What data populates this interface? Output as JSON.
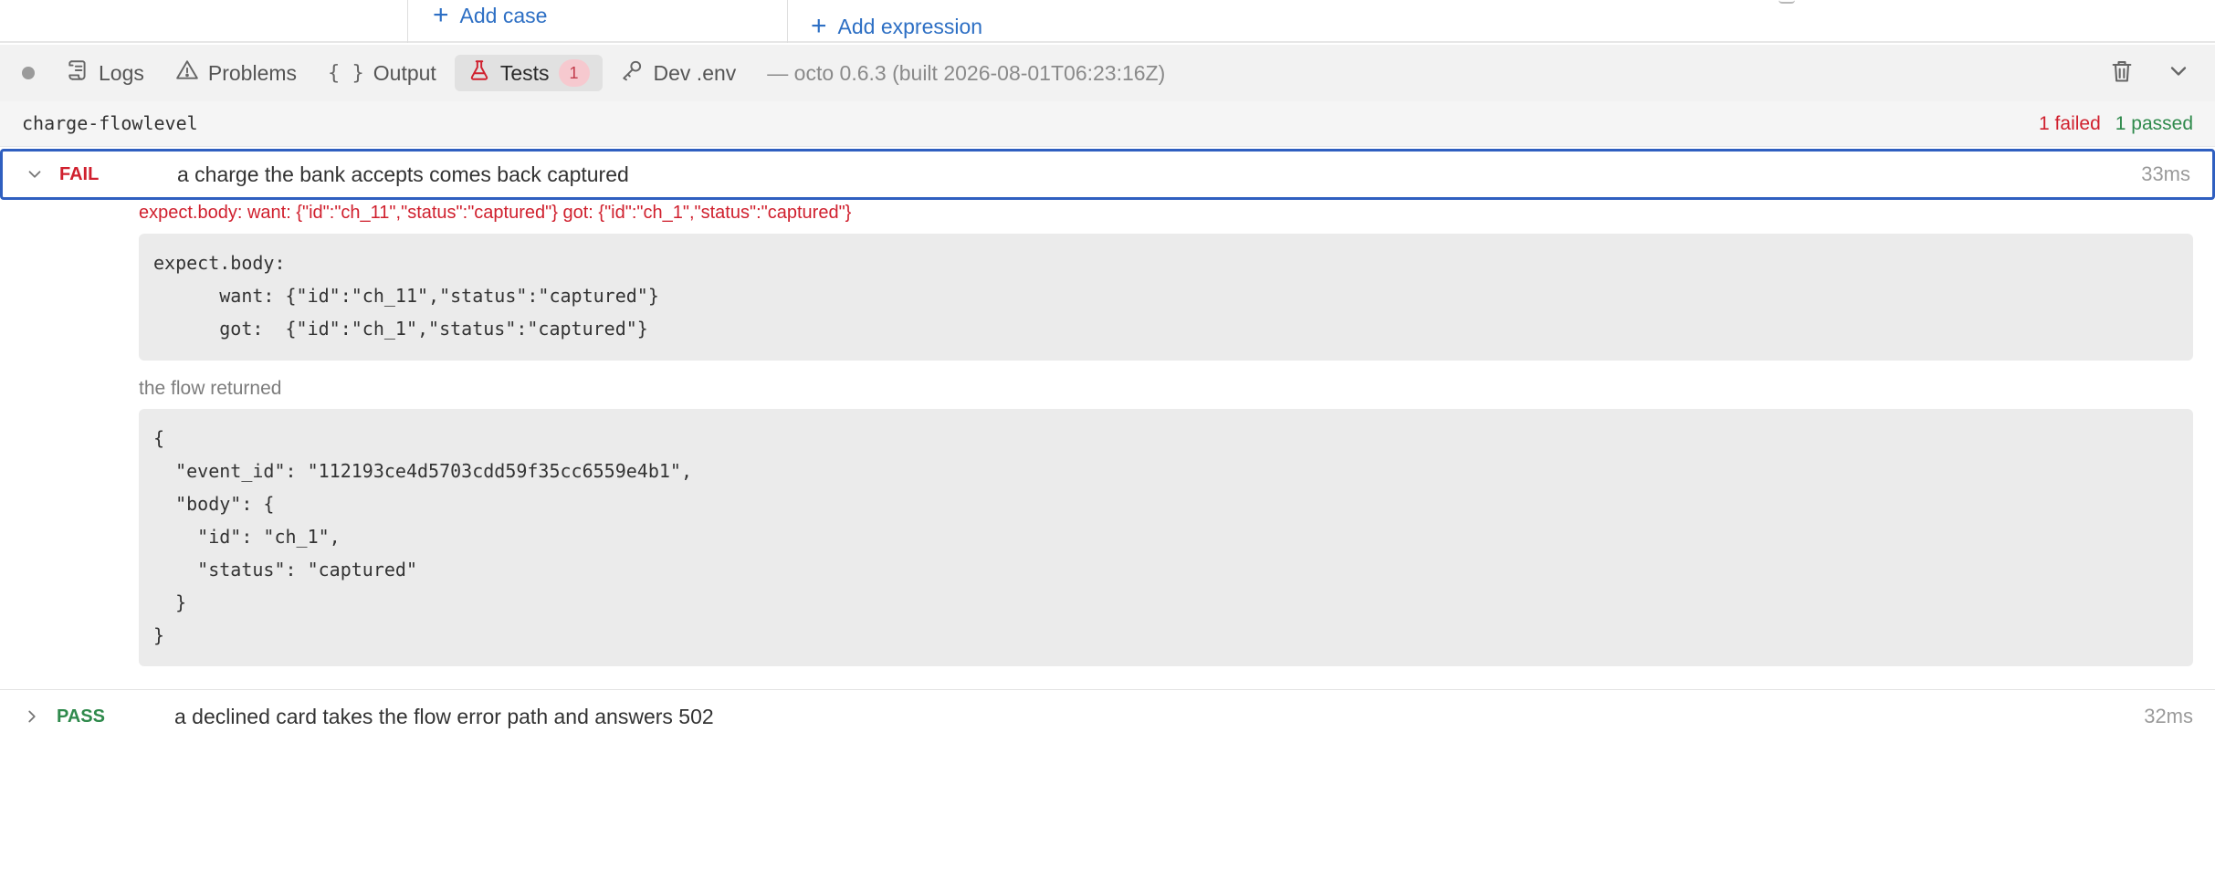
{
  "top": {
    "add_case": "Add case",
    "add_expression": "Add expression"
  },
  "tabs": [
    {
      "label": "Logs",
      "icon": "logs-icon"
    },
    {
      "label": "Problems",
      "icon": "warning-icon"
    },
    {
      "label": "Output",
      "icon": "braces-icon"
    },
    {
      "label": "Tests",
      "icon": "flask-icon",
      "badge": "1",
      "active": true
    },
    {
      "label": "Dev .env",
      "icon": "key-icon"
    }
  ],
  "version": "— octo 0.6.3 (built 2026-08-01T06:23:16Z)",
  "suite": {
    "name": "charge-flowlevel",
    "failed": "1 failed",
    "passed": "1 passed"
  },
  "tests": [
    {
      "status": "FAIL",
      "title": "a charge the bank accepts comes back captured",
      "duration": "33ms",
      "expanded": true,
      "error": "expect.body: want: {\"id\":\"ch_11\",\"status\":\"captured\"} got: {\"id\":\"ch_1\",\"status\":\"captured\"}",
      "diff": "expect.body:\n      want: {\"id\":\"ch_11\",\"status\":\"captured\"}\n      got:  {\"id\":\"ch_1\",\"status\":\"captured\"}",
      "returned_label": "the flow returned",
      "returned": "{\n  \"event_id\": \"112193ce4d5703cdd59f35cc6559e4b1\",\n  \"body\": {\n    \"id\": \"ch_1\",\n    \"status\": \"captured\"\n  }\n}"
    },
    {
      "status": "PASS",
      "title": "a declined card takes the flow error path and answers 502",
      "duration": "32ms",
      "expanded": false
    }
  ],
  "colors": {
    "fail": "#d0202e",
    "pass": "#2f8a4c",
    "accent": "#2d6fc4",
    "selection": "#2f5fc0"
  }
}
